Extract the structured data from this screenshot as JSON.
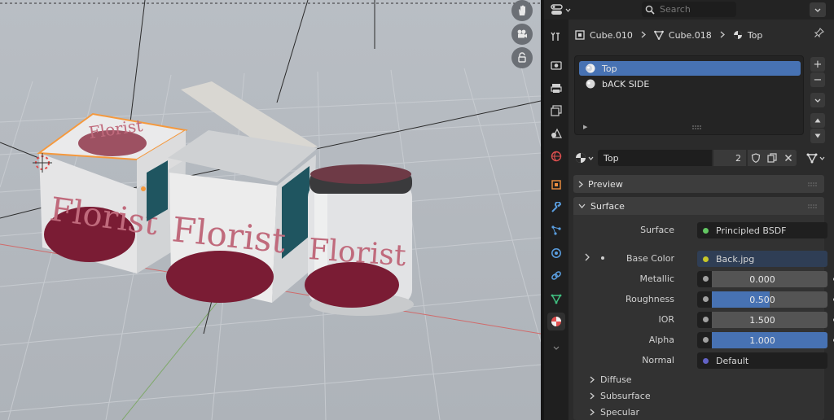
{
  "colors": {
    "accent": "#4772b3",
    "shader_socket": "#63c763",
    "color_socket": "#c7c729",
    "float_socket": "#a1a1a1",
    "vector_socket": "#6363c7",
    "selection_orange": "#f5993d"
  },
  "viewport": {
    "label_text": "Florist",
    "scene_objects": [
      "box-left",
      "box-open",
      "jar"
    ],
    "tools": [
      {
        "name": "hand-icon"
      },
      {
        "name": "camera-icon"
      },
      {
        "name": "lock-icon"
      }
    ]
  },
  "header": {
    "search_placeholder": "Search"
  },
  "tabs": [
    {
      "icon": "tool-icon"
    },
    {
      "icon": "render-icon"
    },
    {
      "icon": "output-icon"
    },
    {
      "icon": "view-layer-icon"
    },
    {
      "icon": "scene-icon"
    },
    {
      "icon": "world-icon"
    },
    {
      "icon": "object-icon"
    },
    {
      "icon": "modifier-icon"
    },
    {
      "icon": "particles-icon"
    },
    {
      "icon": "physics-icon"
    },
    {
      "icon": "constraints-icon"
    },
    {
      "icon": "data-icon"
    },
    {
      "icon": "material-icon"
    }
  ],
  "breadcrumb": {
    "object": "Cube.010",
    "mesh": "Cube.018",
    "material": "Top"
  },
  "material_slots": [
    {
      "name": "Top",
      "active": true
    },
    {
      "name": "bACK SIDE",
      "active": false
    }
  ],
  "material": {
    "name": "Top",
    "users": "2"
  },
  "panels": {
    "preview": "Preview",
    "surface": "Surface"
  },
  "surface": {
    "surface_label": "Surface",
    "surface_value": "Principled BSDF",
    "base_color_label": "Base Color",
    "base_color_value": "Back.jpg",
    "metallic_label": "Metallic",
    "metallic_value": "0.000",
    "metallic_fraction": 0.0,
    "roughness_label": "Roughness",
    "roughness_value": "0.500",
    "roughness_fraction": 0.5,
    "ior_label": "IOR",
    "ior_value": "1.500",
    "ior_fraction": 0.0,
    "alpha_label": "Alpha",
    "alpha_value": "1.000",
    "alpha_fraction": 1.0,
    "normal_label": "Normal",
    "normal_value": "Default"
  },
  "subpanels": [
    "Diffuse",
    "Subsurface",
    "Specular"
  ]
}
